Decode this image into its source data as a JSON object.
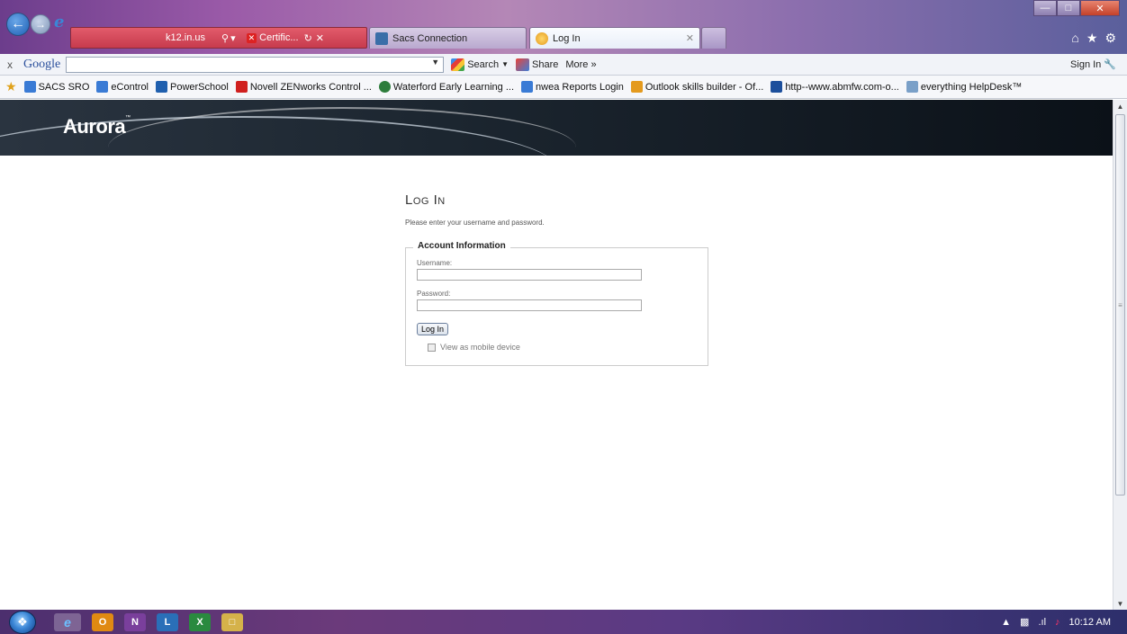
{
  "browser": {
    "address_url": "k12.in.us",
    "cert_label": "Certific...",
    "tabs": [
      {
        "label": "Sacs Connection"
      },
      {
        "label": "Log In"
      }
    ]
  },
  "google_toolbar": {
    "close": "x",
    "logo": "Google",
    "search_label": "Search",
    "share_label": "Share",
    "more_label": "More »",
    "signin_label": "Sign In"
  },
  "favorites": [
    {
      "label": "SACS SRO",
      "icon": "ie-page-icon",
      "color": "#3a7bd5"
    },
    {
      "label": "eControl",
      "icon": "ie-page-icon",
      "color": "#3a7bd5"
    },
    {
      "label": "PowerSchool",
      "icon": "powerschool-icon",
      "color": "#1f5fae"
    },
    {
      "label": "Novell ZENworks Control ...",
      "icon": "novell-icon",
      "color": "#d0201f"
    },
    {
      "label": "Waterford Early Learning ...",
      "icon": "globe-icon",
      "color": "#2d7d3c"
    },
    {
      "label": "nwea Reports Login",
      "icon": "ie-page-icon",
      "color": "#3a7bd5"
    },
    {
      "label": "Outlook skills builder - Of...",
      "icon": "office-icon",
      "color": "#e49a1e"
    },
    {
      "label": "http--www.abmfw.com-o...",
      "icon": "abm-icon",
      "color": "#1c4f9c"
    },
    {
      "label": "everything HelpDesk™",
      "icon": "helpdesk-icon",
      "color": "#7aa0c8"
    }
  ],
  "page": {
    "logo": "Aurora",
    "logo_tm": "™",
    "title": "Log In",
    "instructions": "Please enter your username and password.",
    "account_legend": "Account Information",
    "username_label": "Username:",
    "password_label": "Password:",
    "login_button": "Log In",
    "mobile_label": "View as mobile device"
  },
  "taskbar": {
    "apps": [
      "internet-explorer",
      "outlook",
      "onenote",
      "lync",
      "excel",
      "file-explorer"
    ],
    "time": "10:12 AM"
  }
}
